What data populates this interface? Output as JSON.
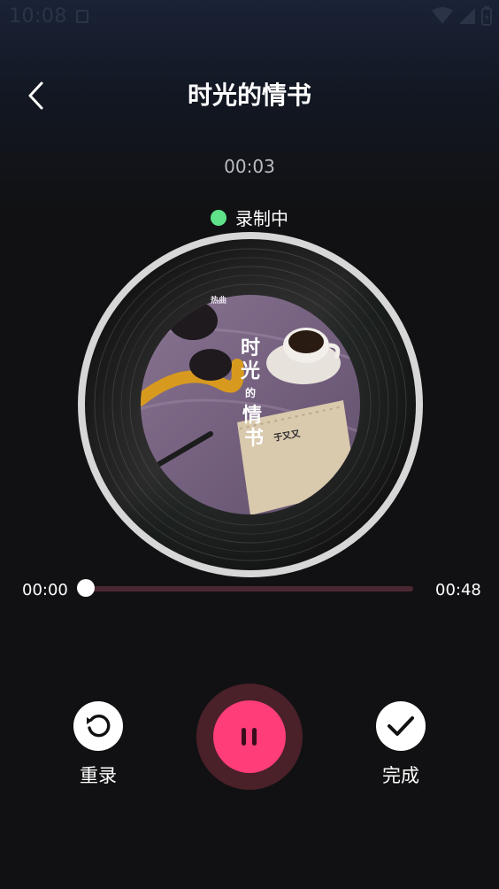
{
  "status_bar": {
    "time": "10:08",
    "notification_icon": "notification-icon",
    "wifi_icon": "wifi-icon",
    "signal_icon": "cell-signal-icon",
    "battery_icon": "battery-icon"
  },
  "header": {
    "back_icon": "chevron-left-icon",
    "title": "时光的情书"
  },
  "recording": {
    "elapsed": "00:03",
    "status_label": "录制中",
    "status_color": "#5ee38a"
  },
  "album_cover": {
    "title_chars": [
      "时",
      "光",
      "的",
      "情",
      "书"
    ],
    "artist": "于又又",
    "badge": "热曲"
  },
  "progress": {
    "start": "00:00",
    "end": "00:48",
    "fraction": 0
  },
  "controls": {
    "rerecord_label": "重录",
    "done_label": "完成",
    "rerecord_icon": "rotate-ccw-icon",
    "pause_icon": "pause-icon",
    "done_icon": "checkmark-icon"
  },
  "colors": {
    "accent": "#ff3d79",
    "accent_ring": "#4a2029",
    "track": "#4a2832"
  }
}
